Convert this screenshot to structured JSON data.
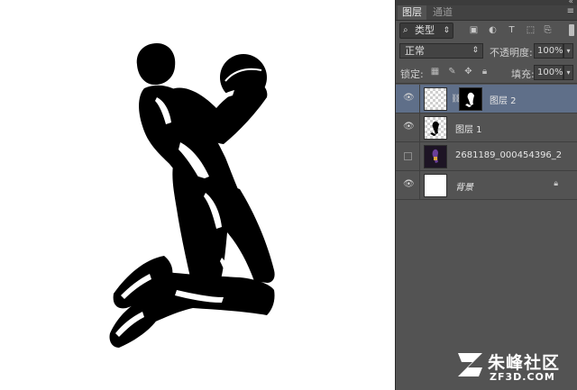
{
  "panel": {
    "tabs": [
      {
        "label": "图层"
      },
      {
        "label": "通道"
      }
    ],
    "filter": {
      "label": "类型"
    },
    "blend_mode": "正常",
    "opacity": {
      "label": "不透明度:",
      "value": "100%"
    },
    "lock": {
      "label": "锁定:"
    },
    "fill": {
      "label": "填充:",
      "value": "100%"
    },
    "layers": [
      {
        "name": "图层 2",
        "visible": true,
        "selected": true,
        "has_mask": true
      },
      {
        "name": "图层 1",
        "visible": true,
        "selected": false
      },
      {
        "name": "2681189_000454396_2",
        "visible": false,
        "selected": false
      },
      {
        "name": "背景",
        "visible": true,
        "selected": false,
        "locked": true
      }
    ]
  },
  "watermark": {
    "text_cn": "朱峰社区",
    "text_en": "ZF3D.COM"
  },
  "colors": {
    "panel_bg": "#535353",
    "selected_layer": "#5f6f89",
    "canvas_bg": "#ffffff"
  }
}
